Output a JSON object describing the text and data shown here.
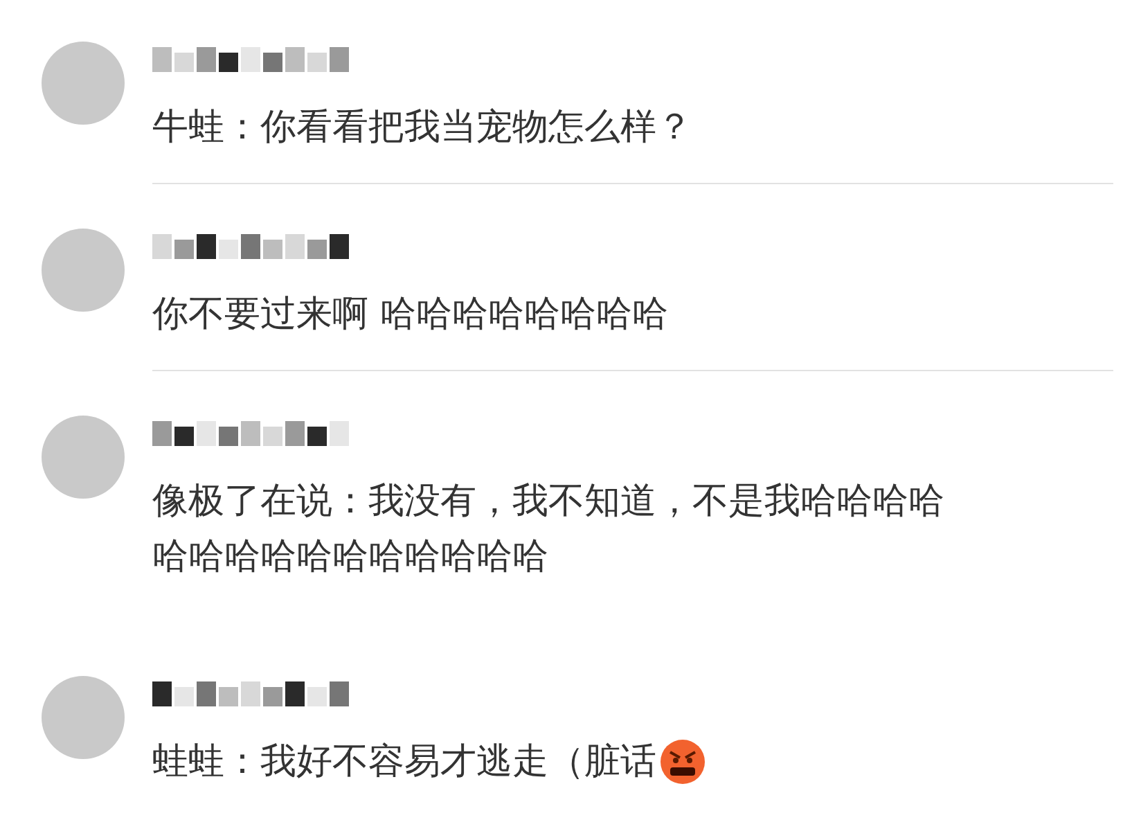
{
  "comments": [
    {
      "text_lines": [
        "牛蛙：你看看把我当宠物怎么样？"
      ],
      "emoji": false,
      "divider": true
    },
    {
      "text_lines": [
        "你不要过来啊 哈哈哈哈哈哈哈哈"
      ],
      "emoji": false,
      "divider": true
    },
    {
      "text_lines": [
        "像极了在说：我没有，我不知道，不是我哈哈哈哈",
        "哈哈哈哈哈哈哈哈哈哈哈"
      ],
      "emoji": false,
      "divider": false
    },
    {
      "text_lines": [
        "蛙蛙：我好不容易才逃走（脏话"
      ],
      "emoji": true,
      "divider": false
    }
  ]
}
